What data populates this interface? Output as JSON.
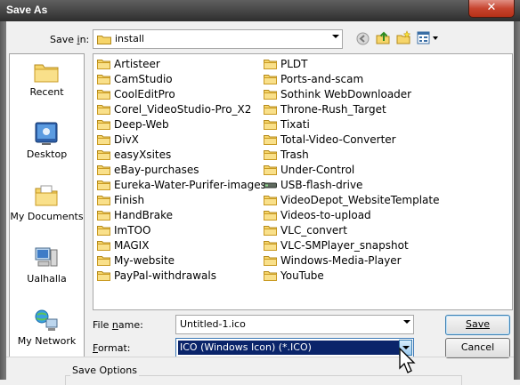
{
  "window": {
    "title": "Save As",
    "close_glyph": "✕"
  },
  "save_in": {
    "label_prefix": "Save ",
    "label_underlined": "i",
    "label_suffix": "n:",
    "value": "install",
    "icon": "folder-icon"
  },
  "toolbar": {
    "icons": [
      "back-icon",
      "up-folder-icon",
      "new-folder-icon",
      "view-menu-icon"
    ]
  },
  "places": [
    {
      "label": "Recent",
      "icon": "recent-places-icon"
    },
    {
      "label": "Desktop",
      "icon": "desktop-icon"
    },
    {
      "label": "My Documents",
      "icon": "my-documents-icon"
    },
    {
      "label": "Ualhalla",
      "icon": "computer-icon"
    },
    {
      "label": "My Network",
      "icon": "network-icon"
    }
  ],
  "files_col1": [
    "Artisteer",
    "CamStudio",
    "CoolEditPro",
    "Corel_VideoStudio-Pro_X2",
    "Deep-Web",
    "DivX",
    "easyXsites",
    "eBay-purchases",
    "Eureka-Water-Purifer-images",
    "Finish",
    "HandBrake",
    "ImTOO",
    "MAGIX",
    "My-website",
    "PayPal-withdrawals"
  ],
  "files_col2": [
    "PLDT",
    "Ports-and-scam",
    "Sothink WebDownloader",
    "Throne-Rush_Target",
    "Tixati",
    "Total-Video-Converter",
    "Trash",
    "Under-Control",
    "USB-flash-drive",
    "VideoDepot_WebsiteTemplate",
    "Videos-to-upload",
    "VLC_convert",
    "VLC-SMPlayer_snapshot",
    "Windows-Media-Player",
    "YouTube"
  ],
  "file_name": {
    "label_prefix": "File ",
    "label_underlined": "n",
    "label_suffix": "ame:",
    "value": "Untitled-1.ico"
  },
  "format": {
    "label_underlined": "F",
    "label_suffix": "ormat:",
    "value": "ICO (Windows Icon) (*.ICO)"
  },
  "buttons": {
    "save": "Save",
    "cancel": "Cancel"
  },
  "save_options": {
    "label": "Save Options"
  },
  "colors": {
    "folder": "#f2c94a",
    "selection": "#0a246a",
    "titlebar": "#3a3a3a",
    "close": "#c7452f"
  }
}
